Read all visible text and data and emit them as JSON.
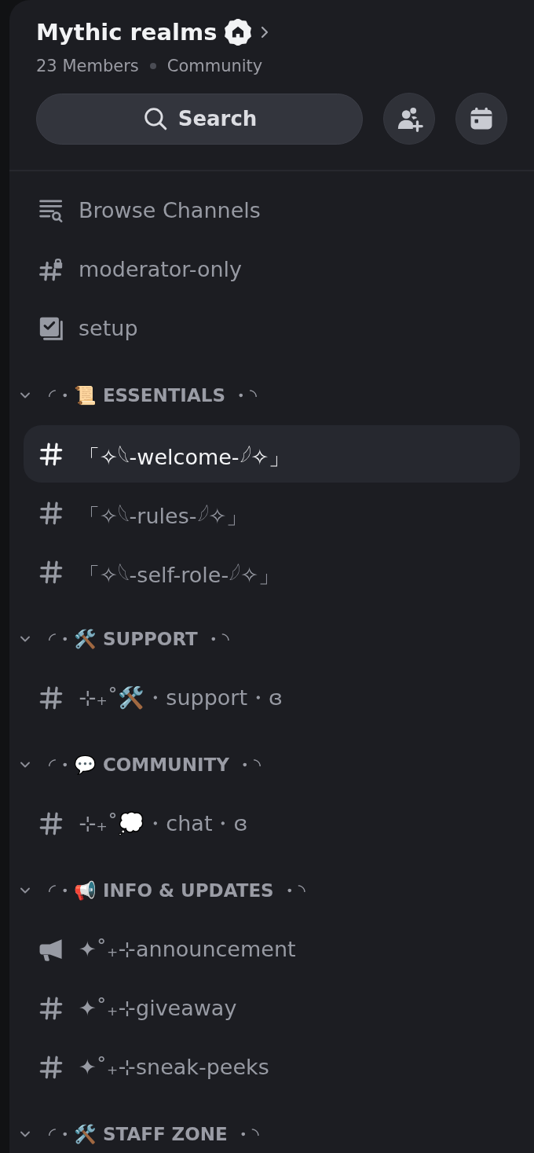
{
  "server": {
    "name": "Mythic realms",
    "members": "23 Members",
    "type": "Community"
  },
  "toolbar": {
    "search": "Search"
  },
  "shortcuts": [
    {
      "kind": "browse",
      "label": "Browse Channels"
    },
    {
      "kind": "locked",
      "label": "moderator-only"
    },
    {
      "kind": "onboarding",
      "label": "setup"
    }
  ],
  "categories": [
    {
      "name": "◜・📜 ESSENTIALS ・◝",
      "expanded": true,
      "channels": [
        {
          "kind": "text",
          "name": "「✧𓆩-welcome-𓆪✧」",
          "selected": true
        },
        {
          "kind": "text",
          "name": "「✧𓆩-rules-𓆪✧」",
          "selected": false
        },
        {
          "kind": "text",
          "name": "「✧𓆩-self-role-𓆪✧」",
          "selected": false
        }
      ]
    },
    {
      "name": "◜・🛠️ SUPPORT ・◝",
      "expanded": true,
      "channels": [
        {
          "kind": "text",
          "name": "⊹₊˚🛠️・support・ɞ",
          "selected": false
        }
      ]
    },
    {
      "name": "◜・💬 COMMUNITY ・◝",
      "expanded": true,
      "channels": [
        {
          "kind": "text",
          "name": "⊹₊˚💭・chat・ɞ",
          "selected": false
        }
      ]
    },
    {
      "name": "◜・📢 INFO & UPDATES ・◝",
      "expanded": true,
      "channels": [
        {
          "kind": "announcement",
          "name": "✦˚₊⊹announcement",
          "selected": false
        },
        {
          "kind": "text",
          "name": "✦˚₊⊹giveaway",
          "selected": false
        },
        {
          "kind": "text",
          "name": "✦˚₊⊹sneak-peeks",
          "selected": false
        }
      ]
    },
    {
      "name": "◜・🛠️ STAFF ZONE ・◝",
      "expanded": true
    }
  ]
}
